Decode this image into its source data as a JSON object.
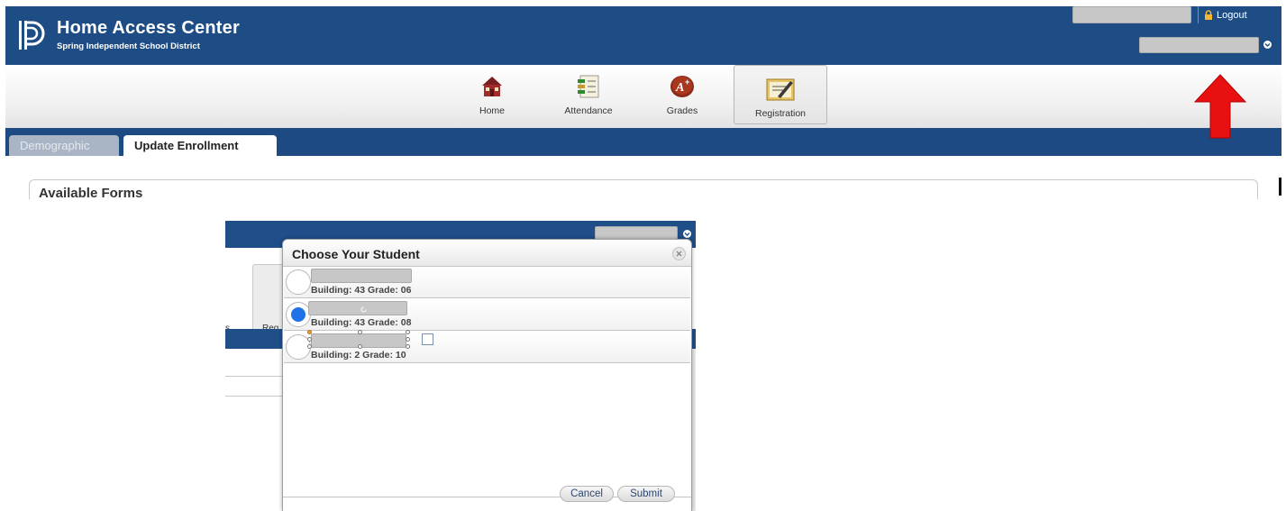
{
  "header": {
    "app_title": "Home Access Center",
    "district": "Spring Independent School District",
    "logout_label": "Logout",
    "logo_icon": "powerschool-logo-icon",
    "bg_color": "#1e4d86"
  },
  "nav": {
    "items": [
      {
        "label": "Home",
        "icon": "home-icon",
        "active": false
      },
      {
        "label": "Attendance",
        "icon": "attendance-icon",
        "active": false
      },
      {
        "label": "Grades",
        "icon": "grades-icon",
        "active": false
      },
      {
        "label": "Registration",
        "icon": "registration-icon",
        "active": true
      }
    ]
  },
  "tabs": [
    {
      "label": "Demographic",
      "active": false
    },
    {
      "label": "Update Enrollment",
      "active": true
    }
  ],
  "forms_panel": {
    "title": "Available Forms"
  },
  "annotation": {
    "arrow_color": "#e81010",
    "points_to": "student selector dropdown"
  },
  "dialog": {
    "title": "Choose Your Student",
    "background_fragments": {
      "nav_text_left": "s",
      "nav_text_right": "Reg"
    },
    "students": [
      {
        "building_grade": "Building: 43 Grade: 06",
        "selected": false
      },
      {
        "building_grade": "Building: 43 Grade: 08",
        "selected": true
      },
      {
        "building_grade": "Building: 2 Grade: 10",
        "selected": false
      }
    ],
    "buttons": {
      "cancel": "Cancel",
      "submit": "Submit"
    },
    "selected_color": "#1e73e8"
  }
}
